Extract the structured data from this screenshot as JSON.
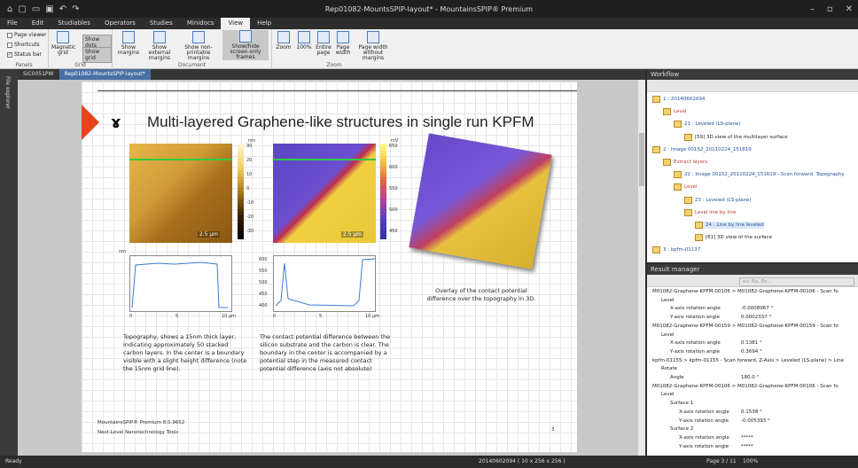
{
  "window": {
    "title": "Rep01082-MountsSPIP-layout* - MountainsSPIP® Premium"
  },
  "menu": [
    "File",
    "Edit",
    "Studiables",
    "Operators",
    "Studies",
    "Minidocs",
    "View",
    "Help"
  ],
  "ribbon": {
    "panels_checks": [
      {
        "label": "Page viewer",
        "checked": false
      },
      {
        "label": "Shortcuts",
        "checked": false
      },
      {
        "label": "Status bar",
        "checked": true
      }
    ],
    "panels_label": "Panels",
    "grid_btn": "Magnetic grid",
    "show_dots": "Show dots",
    "show_grid": "Show grid",
    "grid_label": "Grid",
    "doc_btns": [
      "Show margins",
      "Show external margins",
      "Show non-printable margins",
      "Show/hide screen-only frames"
    ],
    "doc_label": "Document",
    "zoom_btns": [
      "Zoom",
      "100%",
      "Entire page",
      "Page width",
      "Page width without margins"
    ],
    "zoom_label": "Zoom"
  },
  "left_tab": "File explorer",
  "doc_tabs": [
    "SiC0051PW",
    "Rep01082-MountsSPIP-layout*"
  ],
  "page": {
    "title": "Multi-layered Graphene-like structures in single run KPFM",
    "img1_scale": "2.5 µm",
    "img2_scale": "2.5 µm",
    "cbar1_unit": "nm",
    "cbar1_ticks": [
      "30",
      "20",
      "10",
      "0",
      "-10",
      "-20",
      "-30"
    ],
    "cbar2_unit": "mV",
    "cbar2_ticks": [
      "650",
      "600",
      "550",
      "500",
      "450"
    ],
    "plot1_unit": "nm",
    "plot1_xticks": [
      "0",
      "5",
      "10 µm"
    ],
    "plot2_yticks": [
      "600",
      "550",
      "500",
      "450",
      "400"
    ],
    "plot2_xticks": [
      "0",
      "5",
      "10 µm"
    ],
    "text1": "Topography, shows a 15nm thick layer, indicating approximately 50 stacked carbon layers. In the center is a boundary visible with a slight height difference (note the 15nm grid line).",
    "text2": "The contact potential difference between the silicon substrate and the carbon is clear. The boundary in the center is accompanied by a potential step in the measured contact potential difference (axis not absolute)",
    "caption3": "Overlay of the contact potential difference over the topography in 3D.",
    "footer1": "MountainsSPIP® Premium 8.0.9652",
    "footer2": "Next-Level Nanotechnology Tools",
    "page_num": "3"
  },
  "workflow": {
    "header": "Workflow",
    "rows": [
      {
        "text": "1 : 20140602094",
        "style": "blue",
        "indent": 0
      },
      {
        "text": "Level",
        "style": "red",
        "indent": 1
      },
      {
        "text": "21 : Leveled (LS-plane)",
        "style": "blue",
        "indent": 2
      },
      {
        "text": "[59] 3D view of the multilayer surface",
        "style": "",
        "indent": 3
      },
      {
        "text": "2 : Image 00152_20110224_151619",
        "style": "blue",
        "indent": 0
      },
      {
        "text": "Extract layers",
        "style": "red",
        "indent": 1
      },
      {
        "text": "22 : Image 00152_20110224_151619 - Scan forward, Topography",
        "style": "blue",
        "indent": 2
      },
      {
        "text": "Level",
        "style": "red",
        "indent": 2
      },
      {
        "text": "23 : Leveled (LS-plane)",
        "style": "blue",
        "indent": 3
      },
      {
        "text": "Level line by line",
        "style": "red",
        "indent": 3
      },
      {
        "text": "24 : Line by line leveled",
        "style": "blue sel",
        "indent": 4
      },
      {
        "text": "[61] 3D view of the surface",
        "style": "",
        "indent": 4
      },
      {
        "text": "3 : kpfm-01137",
        "style": "blue",
        "indent": 0
      }
    ]
  },
  "results": {
    "header": "Result manager",
    "search_placeholder": "ex: Ra, Rz...",
    "rows": [
      {
        "text": "M01082-Graphene-KPFM-00106 > M01082-Graphene-KPFM-00106 - Scan fo",
        "indent": 0
      },
      {
        "text": "Level",
        "indent": 1
      },
      {
        "text": "X-axis rotation angle",
        "val": "-0.0008967 °",
        "indent": 2
      },
      {
        "text": "Y-axis rotation angle",
        "val": "0.0002337 °",
        "indent": 2
      },
      {
        "text": "M01082-Graphene-KPFM-00159 > M01082-Graphene-KPFM-00159 - Scan fo",
        "indent": 0
      },
      {
        "text": "Level",
        "indent": 1
      },
      {
        "text": "X-axis rotation angle",
        "val": "0.1381 °",
        "indent": 2
      },
      {
        "text": "Y-axis rotation angle",
        "val": "0.3694 °",
        "indent": 2
      },
      {
        "text": "kpfm-01155 > kpfm-01155 - Scan forward, Z-Axis > Leveled (LS-plane) > Line",
        "indent": 0
      },
      {
        "text": "Rotate",
        "indent": 1
      },
      {
        "text": "Angle",
        "val": "180.0 °",
        "indent": 2
      },
      {
        "text": "M01082-Graphene-KPFM-00106 > M01082-Graphene-KPFM-00106 - Scan fo",
        "indent": 0
      },
      {
        "text": "Level",
        "indent": 1
      },
      {
        "text": "Surface 1",
        "indent": 2
      },
      {
        "text": "X-axis rotation angle",
        "val": "0.1538 °",
        "indent": 3
      },
      {
        "text": "Y-axis rotation angle",
        "val": "-0.005393 °",
        "indent": 3
      },
      {
        "text": "Surface 2",
        "indent": 2
      },
      {
        "text": "X-axis rotation angle",
        "val": "*****",
        "indent": 3
      },
      {
        "text": "Y-axis rotation angle",
        "val": "*****",
        "indent": 3
      }
    ]
  },
  "status": {
    "left": "Ready",
    "center": "20140602094 ( 10 x 256 x 256 )",
    "page": "Page 3 / 11",
    "zoom": "100%"
  }
}
